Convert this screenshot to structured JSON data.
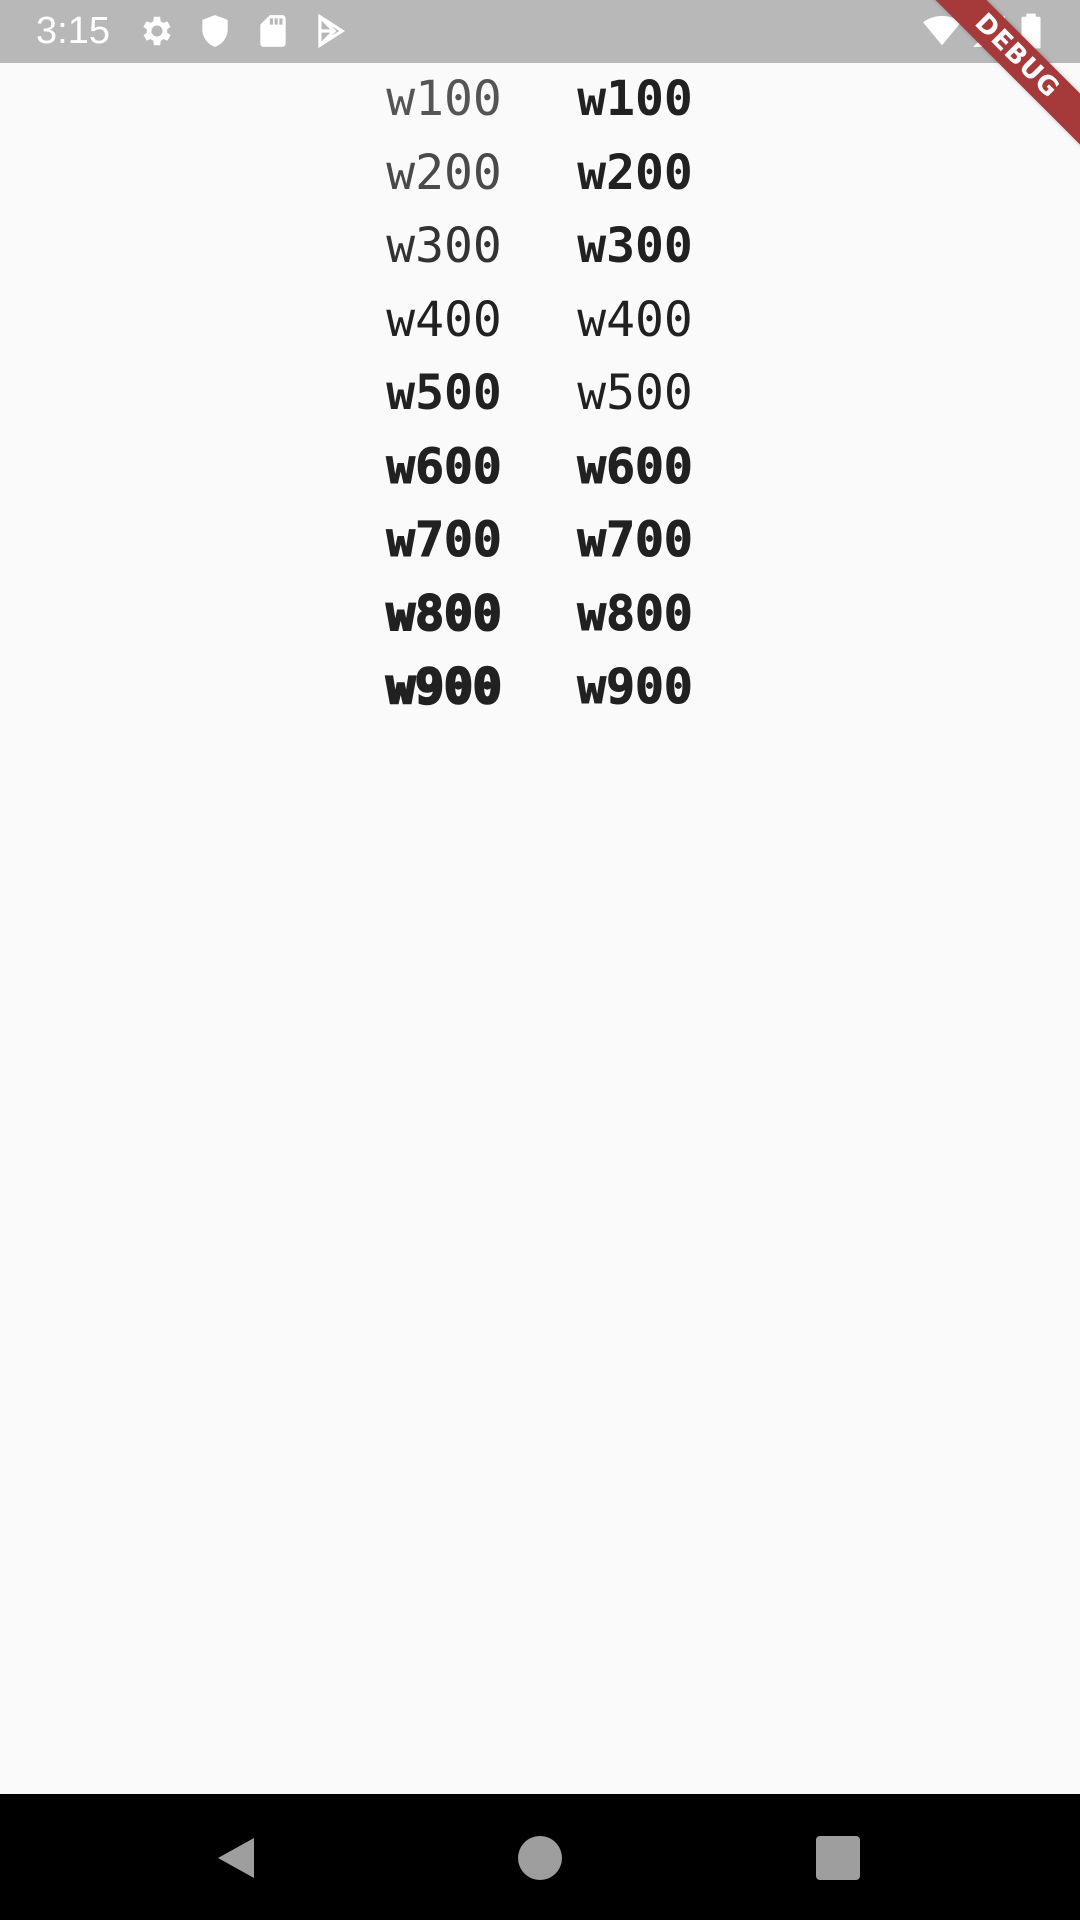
{
  "status_bar": {
    "time": "3:15",
    "icons_left": [
      "gear-icon",
      "shield-icon",
      "sd-card-icon",
      "play-store-icon"
    ],
    "icons_right": [
      "wifi-icon",
      "cell-signal-icon",
      "battery-icon"
    ]
  },
  "debug_banner": {
    "label": "DEBUG",
    "color": "#a63a3a"
  },
  "weights": [
    {
      "left": "w100",
      "right": "w100"
    },
    {
      "left": "w200",
      "right": "w200"
    },
    {
      "left": "w300",
      "right": "w300"
    },
    {
      "left": "w400",
      "right": "w400"
    },
    {
      "left": "w500",
      "right": "w500"
    },
    {
      "left": "w600",
      "right": "w600"
    },
    {
      "left": "w700",
      "right": "w700"
    },
    {
      "left": "w800",
      "right": "w800"
    },
    {
      "left": "w900",
      "right": "w900"
    }
  ],
  "nav_bar": {
    "buttons": [
      "back-icon",
      "home-icon",
      "recents-icon"
    ]
  },
  "colors": {
    "status_bar": "#b8b8b8",
    "background": "#fafafa",
    "text": "#212121",
    "nav_bar": "#000000",
    "nav_buttons": "#9e9e9e"
  }
}
